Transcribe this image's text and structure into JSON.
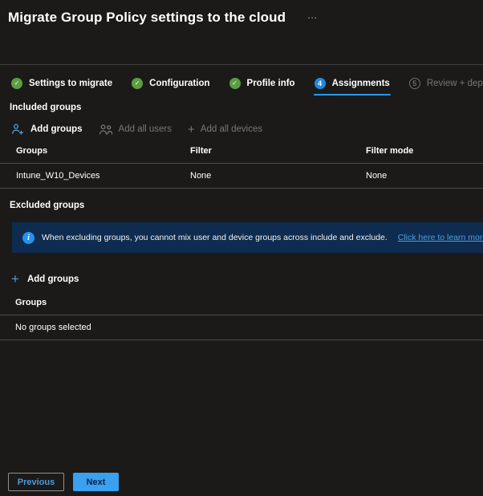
{
  "window": {
    "title": "Migrate Group Policy settings to the cloud",
    "more_actions": "…"
  },
  "icons": {
    "check": "✓",
    "plus": "+",
    "info": "i"
  },
  "stepper": {
    "steps": [
      {
        "label": "Settings to migrate",
        "state": "complete"
      },
      {
        "label": "Configuration",
        "state": "complete"
      },
      {
        "label": "Profile info",
        "state": "complete"
      },
      {
        "label": "Assignments",
        "state": "active",
        "badge": "4"
      },
      {
        "label": "Review + deploy",
        "state": "upcoming",
        "badge": "5"
      }
    ]
  },
  "included_groups": {
    "heading": "Included groups",
    "toolbar": [
      {
        "label": "Add groups",
        "icon": "person-add-icon",
        "enabled": true
      },
      {
        "label": "Add all users",
        "icon": "people-icon",
        "enabled": false
      },
      {
        "label": "Add all devices",
        "icon": "plus-icon",
        "enabled": false
      }
    ],
    "table": {
      "columns": [
        "Groups",
        "Filter",
        "Filter mode"
      ],
      "rows": [
        {
          "group": "Intune_W10_Devices",
          "filter": "None",
          "filter_mode": "None"
        }
      ]
    }
  },
  "excluded_groups": {
    "heading": "Excluded groups",
    "info_banner": {
      "message": "When excluding groups, you cannot mix user and device groups across include and exclude.",
      "link_text": "Click here to learn more about excluding"
    },
    "add_button": "Add groups",
    "table": {
      "columns": [
        "Groups"
      ],
      "empty_text": "No groups selected"
    }
  },
  "footer": {
    "previous_label": "Previous",
    "next_label": "Next"
  },
  "colors": {
    "background": "#1b1a19",
    "accent_blue": "#2899f5",
    "active_badge_blue": "#2288e0",
    "success_green": "#5b9e41",
    "banner_background": "#0d2c4f",
    "link_blue": "#4f9fe0",
    "next_button_blue": "#3aa0f0",
    "disabled_text": "#797775"
  }
}
